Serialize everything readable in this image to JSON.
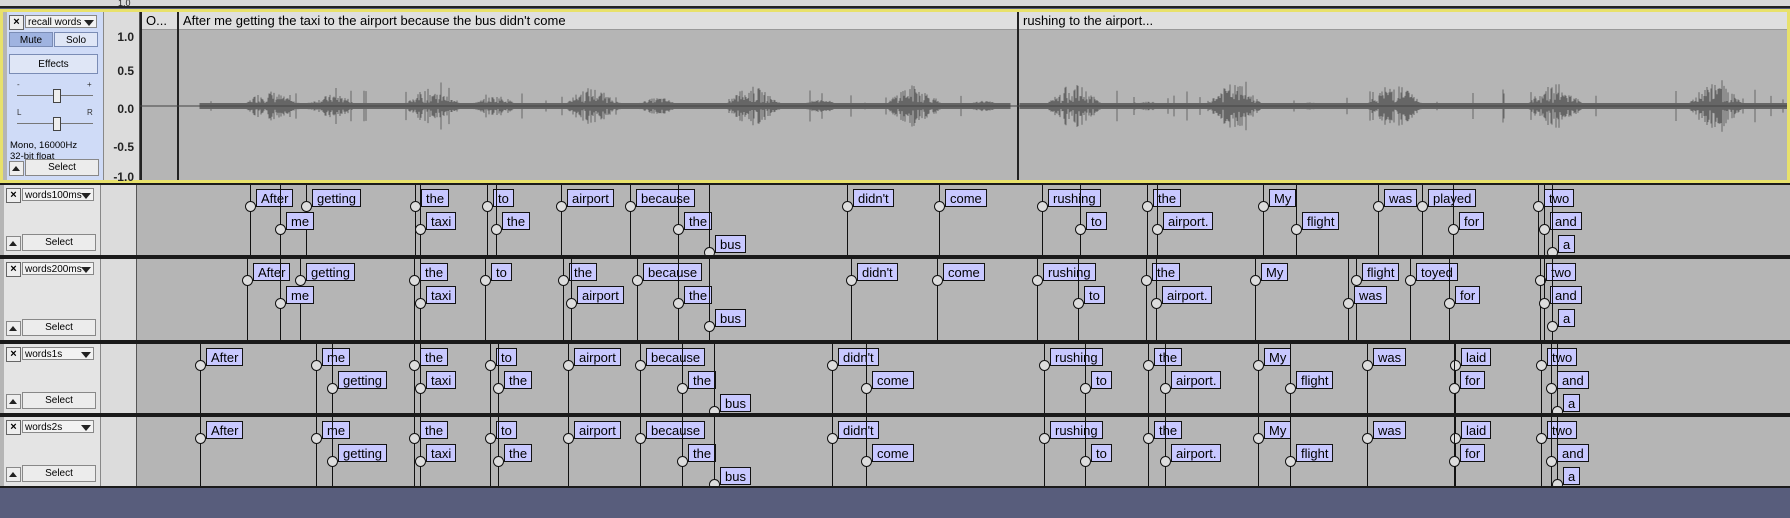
{
  "ruler_partial_value": "1.0",
  "audio_track": {
    "name": "recall words",
    "mute_label": "Mute",
    "solo_label": "Solo",
    "effects_label": "Effects",
    "gain_left": "-",
    "gain_right": "+",
    "pan_left": "L",
    "pan_right": "R",
    "format_line1": "Mono, 16000Hz",
    "format_line2": "32-bit float",
    "select_label": "Select",
    "vruler": [
      "1.0",
      "0.5",
      "0.0",
      "-0.5",
      "-1.0"
    ],
    "clips": [
      "O...",
      "After me getting the taxi to the airport because the bus didn't come",
      "rushing to the airport..."
    ]
  },
  "label_tracks": [
    {
      "name": "words100ms",
      "select_label": "Select",
      "labels": [
        {
          "text": "After",
          "row": 0
        },
        {
          "text": "getting",
          "row": 0
        },
        {
          "text": "me",
          "row": 1
        },
        {
          "text": "the",
          "row": 0
        },
        {
          "text": "taxi",
          "row": 1
        },
        {
          "text": "to",
          "row": 0
        },
        {
          "text": "the",
          "row": 1
        },
        {
          "text": "airport",
          "row": 0
        },
        {
          "text": "because",
          "row": 0
        },
        {
          "text": "the",
          "row": 1
        },
        {
          "text": "bus",
          "row": 2
        },
        {
          "text": "didn't",
          "row": 0
        },
        {
          "text": "come",
          "row": 0
        },
        {
          "text": "rushing",
          "row": 0
        },
        {
          "text": "to",
          "row": 1
        },
        {
          "text": "the",
          "row": 0
        },
        {
          "text": "airport.",
          "row": 1
        },
        {
          "text": "My",
          "row": 0
        },
        {
          "text": "flight",
          "row": 1
        },
        {
          "text": "was",
          "row": 0
        },
        {
          "text": "played",
          "row": 0
        },
        {
          "text": "for",
          "row": 1
        },
        {
          "text": "two",
          "row": 0
        },
        {
          "text": "and",
          "row": 1
        },
        {
          "text": "a",
          "row": 2
        }
      ]
    },
    {
      "name": "words200ms",
      "select_label": "Select",
      "labels": [
        {
          "text": "After",
          "row": 0
        },
        {
          "text": "getting",
          "row": 0
        },
        {
          "text": "me",
          "row": 1
        },
        {
          "text": "the",
          "row": 0
        },
        {
          "text": "taxi",
          "row": 1
        },
        {
          "text": "to",
          "row": 0
        },
        {
          "text": "the",
          "row": 0
        },
        {
          "text": "airport",
          "row": 1
        },
        {
          "text": "because",
          "row": 0
        },
        {
          "text": "the",
          "row": 1
        },
        {
          "text": "bus",
          "row": 2
        },
        {
          "text": "didn't",
          "row": 0
        },
        {
          "text": "come",
          "row": 0
        },
        {
          "text": "rushing",
          "row": 0
        },
        {
          "text": "to",
          "row": 1
        },
        {
          "text": "the",
          "row": 0
        },
        {
          "text": "airport.",
          "row": 1
        },
        {
          "text": "My",
          "row": 0
        },
        {
          "text": "flight",
          "row": 0
        },
        {
          "text": "was",
          "row": 1
        },
        {
          "text": "toyed",
          "row": 0
        },
        {
          "text": "for",
          "row": 1
        },
        {
          "text": "two",
          "row": 0
        },
        {
          "text": "and",
          "row": 1
        },
        {
          "text": "a",
          "row": 2
        }
      ]
    },
    {
      "name": "words1s",
      "select_label": "Select",
      "labels": [
        {
          "text": "After",
          "row": 0
        },
        {
          "text": "me",
          "row": 0
        },
        {
          "text": "getting",
          "row": 1
        },
        {
          "text": "the",
          "row": 0
        },
        {
          "text": "taxi",
          "row": 1
        },
        {
          "text": "to",
          "row": 0
        },
        {
          "text": "the",
          "row": 1
        },
        {
          "text": "airport",
          "row": 0
        },
        {
          "text": "because",
          "row": 0
        },
        {
          "text": "the",
          "row": 1
        },
        {
          "text": "bus",
          "row": 2
        },
        {
          "text": "didn't",
          "row": 0
        },
        {
          "text": "come",
          "row": 1
        },
        {
          "text": "rushing",
          "row": 0
        },
        {
          "text": "to",
          "row": 1
        },
        {
          "text": "the",
          "row": 0
        },
        {
          "text": "airport.",
          "row": 1
        },
        {
          "text": "My",
          "row": 0
        },
        {
          "text": "flight",
          "row": 1
        },
        {
          "text": "was",
          "row": 0
        },
        {
          "text": "laid",
          "row": 0
        },
        {
          "text": "for",
          "row": 1
        },
        {
          "text": "two",
          "row": 0
        },
        {
          "text": "and",
          "row": 1
        },
        {
          "text": "a",
          "row": 2
        }
      ]
    },
    {
      "name": "words2s",
      "select_label": "Select",
      "labels": [
        {
          "text": "After",
          "row": 0
        },
        {
          "text": "me",
          "row": 0
        },
        {
          "text": "getting",
          "row": 1
        },
        {
          "text": "the",
          "row": 0
        },
        {
          "text": "taxi",
          "row": 1
        },
        {
          "text": "to",
          "row": 0
        },
        {
          "text": "the",
          "row": 1
        },
        {
          "text": "airport",
          "row": 0
        },
        {
          "text": "because",
          "row": 0
        },
        {
          "text": "the",
          "row": 1
        },
        {
          "text": "bus",
          "row": 2
        },
        {
          "text": "didn't",
          "row": 0
        },
        {
          "text": "come",
          "row": 1
        },
        {
          "text": "rushing",
          "row": 0
        },
        {
          "text": "to",
          "row": 1
        },
        {
          "text": "the",
          "row": 0
        },
        {
          "text": "airport.",
          "row": 1
        },
        {
          "text": "My",
          "row": 0
        },
        {
          "text": "flight",
          "row": 1
        },
        {
          "text": "was",
          "row": 0
        },
        {
          "text": "laid",
          "row": 0
        },
        {
          "text": "for",
          "row": 1
        },
        {
          "text": "two",
          "row": 0
        },
        {
          "text": "and",
          "row": 1
        },
        {
          "text": "a",
          "row": 2
        }
      ]
    }
  ],
  "colors": {
    "label_fill": "#c8c8ff",
    "selected_track_border": "#e8e16b",
    "background": "#585d7c"
  }
}
